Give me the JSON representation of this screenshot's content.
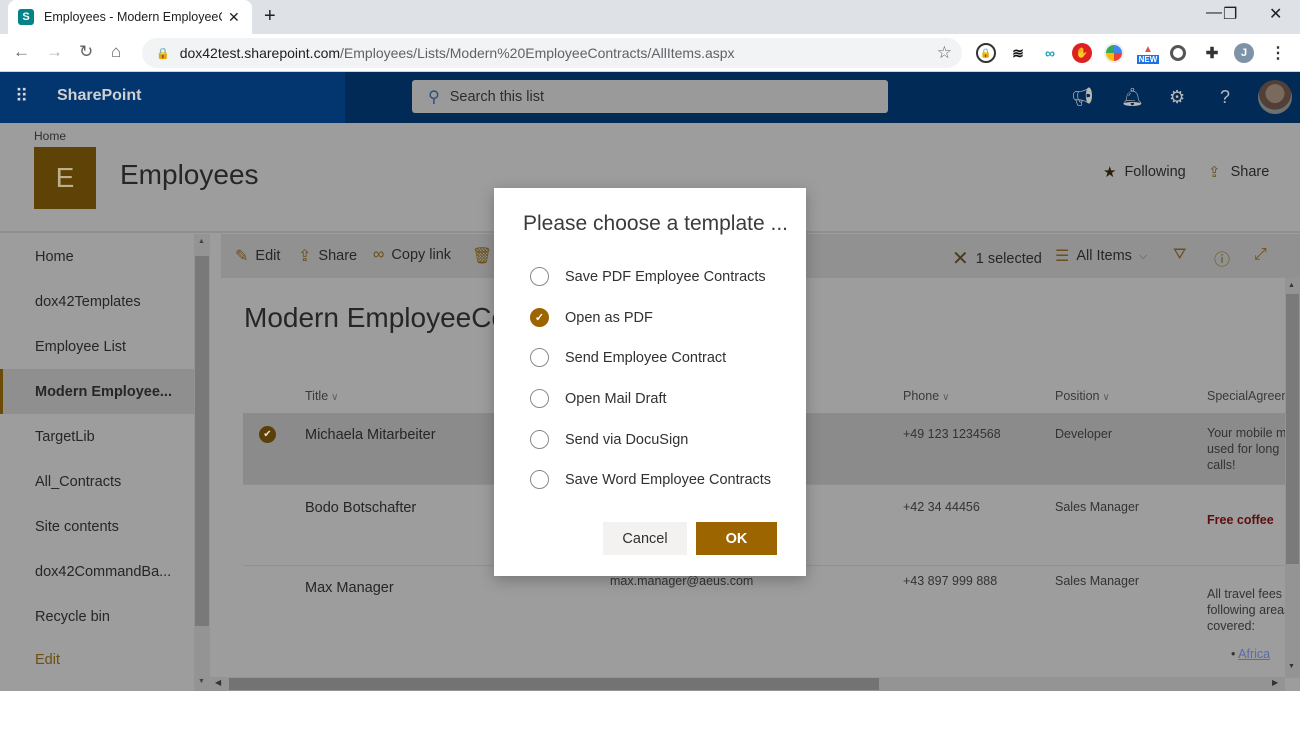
{
  "browser": {
    "tab_title": "Employees - Modern EmployeeContracts",
    "new_tab_label": "+",
    "url_host": "dox42test.sharepoint.com",
    "url_path": "/Employees/Lists/Modern%20EmployeeContracts/AllItems.aspx",
    "profile_initial": "J",
    "extensions": [
      "password-manager-extension",
      "layers-extension",
      "sync-extension",
      "adblock-extension",
      "google-extension",
      "new-badge-extension",
      "circle-extension",
      "puzzle-extensions"
    ],
    "new_badge": "NEW"
  },
  "suitebar": {
    "brand": "SharePoint",
    "search_placeholder": "Search this list"
  },
  "site": {
    "breadcrumb": "Home",
    "logo_letter": "E",
    "title": "Employees",
    "following_label": "Following",
    "share_label": "Share"
  },
  "leftnav": {
    "items": [
      {
        "label": "Home"
      },
      {
        "label": "dox42Templates"
      },
      {
        "label": "Employee List"
      },
      {
        "label": "Modern Employee..."
      },
      {
        "label": "TargetLib"
      },
      {
        "label": "All_Contracts"
      },
      {
        "label": "Site contents"
      },
      {
        "label": "dox42CommandBa..."
      },
      {
        "label": "Recycle bin"
      },
      {
        "label": "Edit"
      }
    ],
    "selected_index": 3
  },
  "commandbar": {
    "edit_label": "Edit",
    "share_label": "Share",
    "copy_link_label": "Copy link",
    "selected_count_label": "1 selected",
    "view_label": "All Items"
  },
  "list": {
    "title": "Modern EmployeeContracts",
    "columns": [
      "Title",
      "Phone",
      "Position",
      "SpecialAgreements"
    ],
    "rows": [
      {
        "title": "Michaela Mitarbeiter",
        "email": "",
        "phone": "+49 123 1234568",
        "position": "Developer",
        "special": [
          "Your mobile may be",
          "used for long",
          "calls!"
        ],
        "selected": true
      },
      {
        "title": "Bodo Botschafter",
        "email": "",
        "phone": "+42 34 44456",
        "position": "Sales Manager",
        "special": [
          "Free coffee"
        ],
        "selected": false
      },
      {
        "title": "Max Manager",
        "email": "max.manager@aeus.com",
        "phone": "+43 897 999 888",
        "position": "Sales Manager",
        "special": [
          "All travel fees",
          "following areas",
          "covered:"
        ],
        "special_links": [
          "Africa"
        ],
        "selected": false
      }
    ]
  },
  "dialog": {
    "title": "Please choose a template ...",
    "options": [
      {
        "label": "Save PDF Employee Contracts",
        "checked": false
      },
      {
        "label": "Open as PDF",
        "checked": true
      },
      {
        "label": "Send Employee Contract",
        "checked": false
      },
      {
        "label": "Open Mail Draft",
        "checked": false
      },
      {
        "label": "Send via DocuSign",
        "checked": false
      },
      {
        "label": "Save Word Employee Contracts",
        "checked": false
      }
    ],
    "cancel_label": "Cancel",
    "ok_label": "OK"
  },
  "colors": {
    "accent": "#9c6500",
    "suitebar": "#03356e",
    "overlay_gray": "#9d9d9d"
  }
}
